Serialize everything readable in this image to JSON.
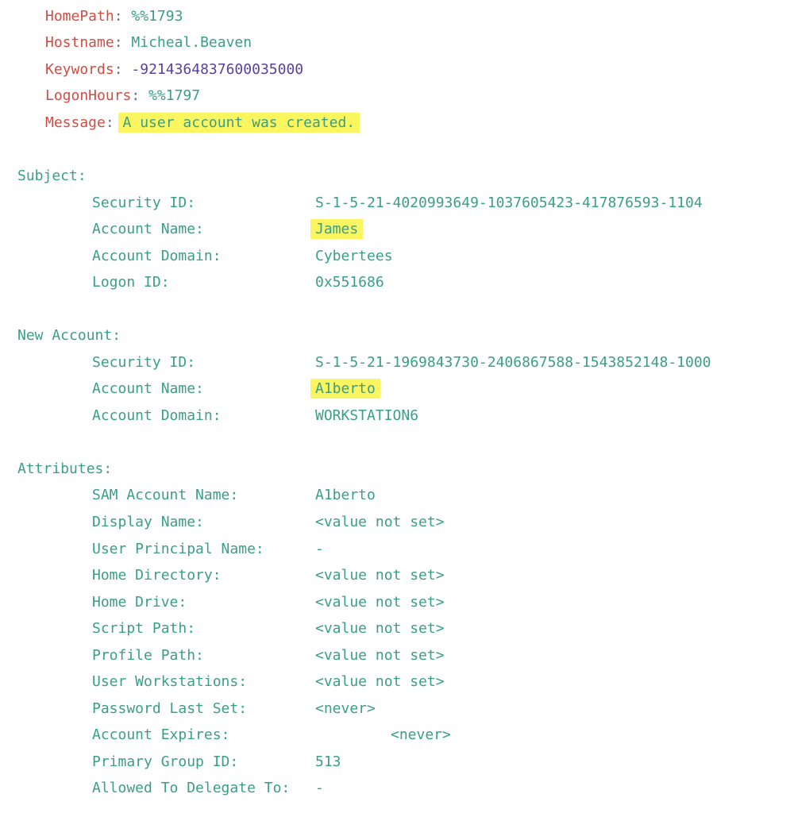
{
  "fields": [
    {
      "key": "HomePath",
      "value": "%%1793"
    },
    {
      "key": "Hostname",
      "value": "Micheal.Beaven"
    },
    {
      "key": "Keywords",
      "value": "-9214364837600035000"
    },
    {
      "key": "LogonHours",
      "value": "%%1797"
    },
    {
      "key": "Message",
      "value": "A user account was created."
    }
  ],
  "colon": ":",
  "highlight_color": "#fbf55f",
  "subject": {
    "header": "Subject:",
    "security_id_label": "Security ID:",
    "security_id": "S-1-5-21-4020993649-1037605423-417876593-1104",
    "account_name_label": "Account Name:",
    "account_name": "James",
    "account_domain_label": "Account Domain:",
    "account_domain": "Cybertees",
    "logon_id_label": "Logon ID:",
    "logon_id": "0x551686"
  },
  "new_account": {
    "header": "New Account:",
    "security_id_label": "Security ID:",
    "security_id": "S-1-5-21-1969843730-2406867588-1543852148-1000",
    "account_name_label": "Account Name:",
    "account_name": "A1berto",
    "account_domain_label": "Account Domain:",
    "account_domain": "WORKSTATION6"
  },
  "attributes": {
    "header": "Attributes:",
    "sam_account_name_label": "SAM Account Name:",
    "sam_account_name": "A1berto",
    "display_name_label": "Display Name:",
    "display_name": "<value not set>",
    "upn_label": "User Principal Name:",
    "upn": "-",
    "home_directory_label": "Home Directory:",
    "home_directory": "<value not set>",
    "home_drive_label": "Home Drive:",
    "home_drive": "<value not set>",
    "script_path_label": "Script Path:",
    "script_path": "<value not set>",
    "profile_path_label": "Profile Path:",
    "profile_path": "<value not set>",
    "user_workstations_label": "User Workstations:",
    "user_workstations": "<value not set>",
    "password_last_set_label": "Password Last Set:",
    "password_last_set": "<never>",
    "account_expires_label": "Account Expires:",
    "account_expires": "<never>",
    "primary_group_id_label": "Primary Group ID:",
    "primary_group_id": "513",
    "allowed_to_delegate_label": "Allowed To Delegate To:",
    "allowed_to_delegate": "-"
  }
}
